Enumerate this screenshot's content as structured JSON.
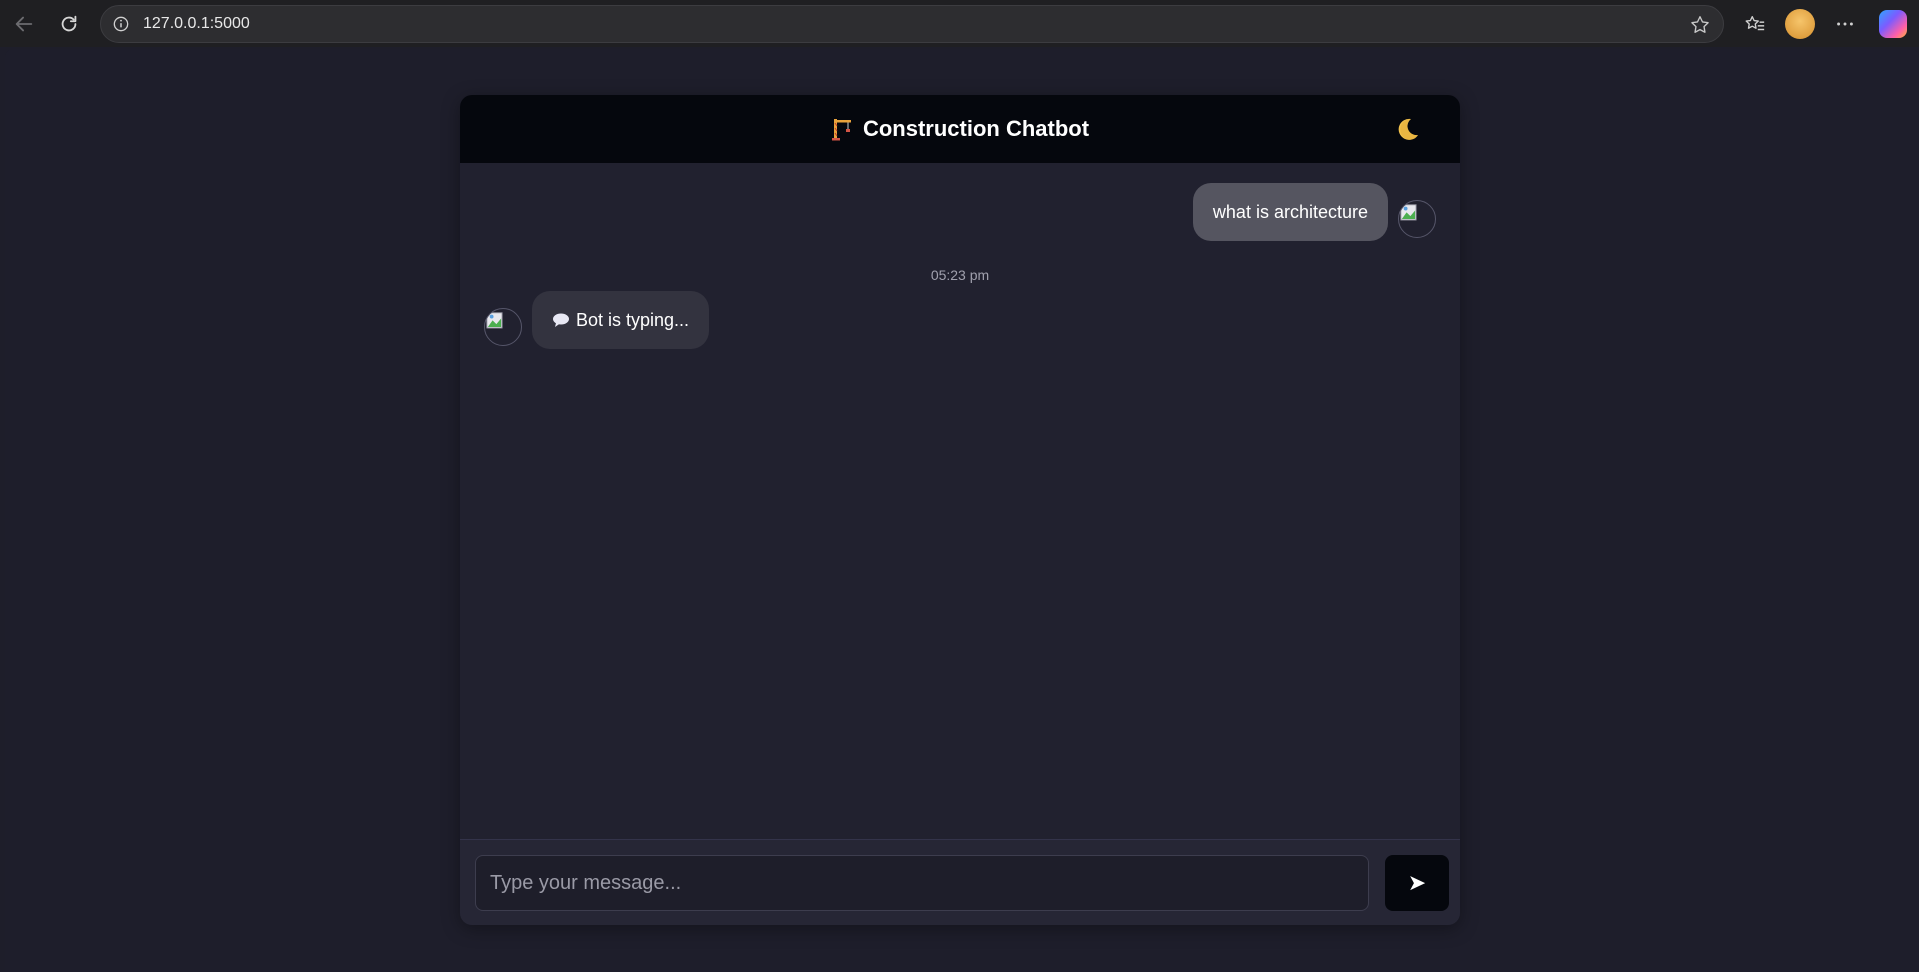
{
  "browser": {
    "url": "127.0.0.1:5000"
  },
  "chat": {
    "title": "Construction Chatbot",
    "title_icon": "crane-icon",
    "theme_toggle_icon": "moon-icon",
    "messages": [
      {
        "sender": "user",
        "text": "what is architecture"
      },
      {
        "sender": "bot",
        "text": "Bot is typing...",
        "icon": "speech-bubble-icon"
      }
    ],
    "timestamp": "05:23 pm",
    "input": {
      "placeholder": "Type your message...",
      "value": ""
    },
    "send_icon": "➤"
  },
  "colors": {
    "header": "#05070d",
    "container": "#21212f",
    "user_bubble": "#555560",
    "bot_bubble": "#33333f"
  }
}
